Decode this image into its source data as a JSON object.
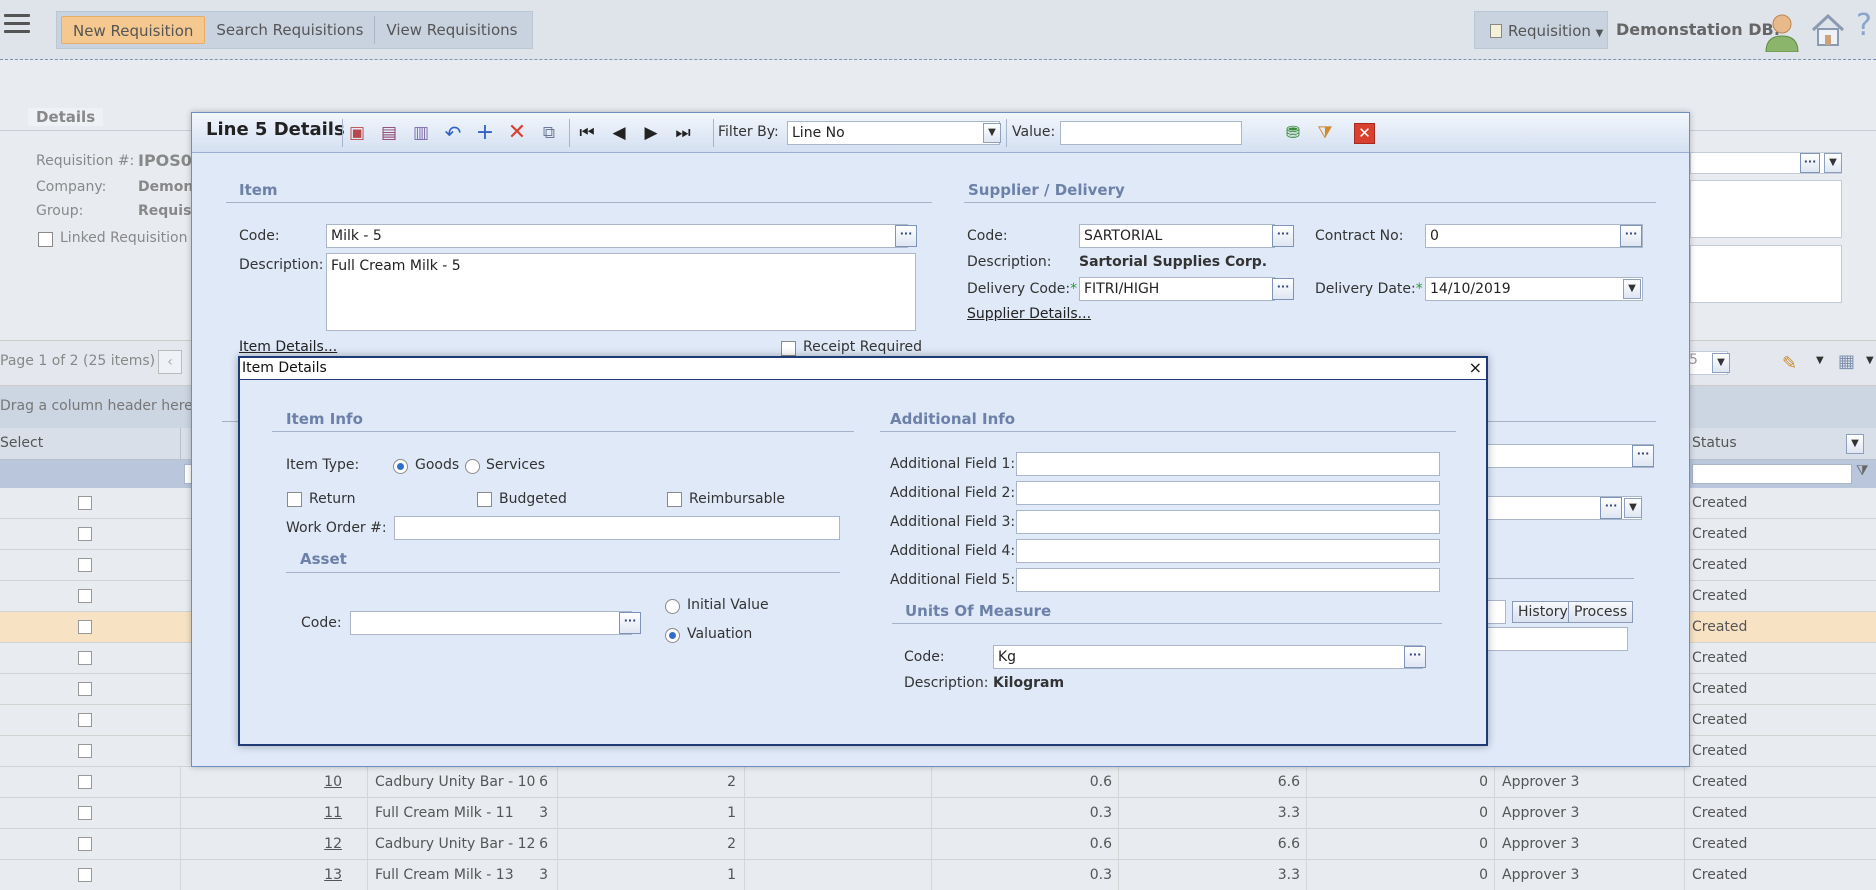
{
  "topbar": {
    "nav": [
      "New Requisition",
      "Search Requisitions",
      "View Requisitions"
    ],
    "requisition_menu": "Requisition",
    "db_name": "Demonstation DB:"
  },
  "background": {
    "details_header": "Details",
    "req_label": "Requisition #:",
    "req_value": "IPOS0",
    "company_label": "Company:",
    "company_value": "Demon",
    "group_label": "Group:",
    "group_value": "Requis",
    "linked_label": "Linked Requisition",
    "pager": "Page 1 of 2 (25 items)",
    "group_hint": "Drag a column header here t",
    "col_select": "Select",
    "col_status": "Status",
    "history_btn": "History",
    "process_btn": "Process",
    "pager_value": "5",
    "status_rows": [
      "Created",
      "Created",
      "Created",
      "Created",
      "Created",
      "Created",
      "Created",
      "Created",
      "Created"
    ],
    "rows": [
      {
        "no": "10",
        "desc": "Cadbury Unity Bar - 10",
        "q1": "6",
        "q2": "2",
        "p": "0.6",
        "t": "6.6",
        "z": "0",
        "appr": "Approver 3",
        "status": "Created"
      },
      {
        "no": "11",
        "desc": "Full Cream Milk - 11",
        "q1": "3",
        "q2": "1",
        "p": "0.3",
        "t": "3.3",
        "z": "0",
        "appr": "Approver 3",
        "status": "Created"
      },
      {
        "no": "12",
        "desc": "Cadbury Unity Bar - 12",
        "q1": "6",
        "q2": "2",
        "p": "0.6",
        "t": "6.6",
        "z": "0",
        "appr": "Approver 3",
        "status": "Created"
      },
      {
        "no": "13",
        "desc": "Full Cream Milk - 13",
        "q1": "3",
        "q2": "1",
        "p": "0.3",
        "t": "3.3",
        "z": "0",
        "appr": "Approver 3",
        "status": "Created"
      }
    ]
  },
  "line_window": {
    "title": "Line 5 Details",
    "filter_label": "Filter By:",
    "filter_value": "Line No",
    "value_label": "Value:",
    "value_input": "",
    "item_section": "Item",
    "code_label": "Code:",
    "code_value": "Milk - 5",
    "desc_label": "Description:",
    "desc_value": "Full Cream Milk - 5",
    "item_details_link": "Item Details...",
    "receipt_required": "Receipt Required",
    "supplier_section": "Supplier / Delivery",
    "sup_code_label": "Code:",
    "sup_code_value": "SARTORIAL",
    "contract_label": "Contract No:",
    "contract_value": "0",
    "sup_desc_label": "Description:",
    "sup_desc_value": "Sartorial Supplies Corp.",
    "delivery_code_label": "Delivery Code:",
    "delivery_code_value": "FITRI/HIGH",
    "delivery_date_label": "Delivery Date:",
    "delivery_date_value": "14/10/2019",
    "required_mark": "*",
    "supplier_details_link": "Supplier Details..."
  },
  "item_dialog": {
    "title": "Item Details",
    "close": "×",
    "item_info": "Item Info",
    "item_type_label": "Item Type:",
    "goods": "Goods",
    "services": "Services",
    "return": "Return",
    "budgeted": "Budgeted",
    "reimbursable": "Reimbursable",
    "work_order_label": "Work Order #:",
    "work_order_value": "",
    "asset": "Asset",
    "asset_code_label": "Code:",
    "asset_code_value": "",
    "initial_value": "Initial Value",
    "valuation": "Valuation",
    "additional_info": "Additional Info",
    "additional_fields": [
      "Additional Field 1:",
      "Additional Field 2:",
      "Additional Field 3:",
      "Additional Field 4:",
      "Additional Field 5:"
    ],
    "uom_section": "Units Of Measure",
    "uom_code_label": "Code:",
    "uom_code_value": "Kg",
    "uom_desc_label": "Description:",
    "uom_desc_value": "Kilogram"
  }
}
